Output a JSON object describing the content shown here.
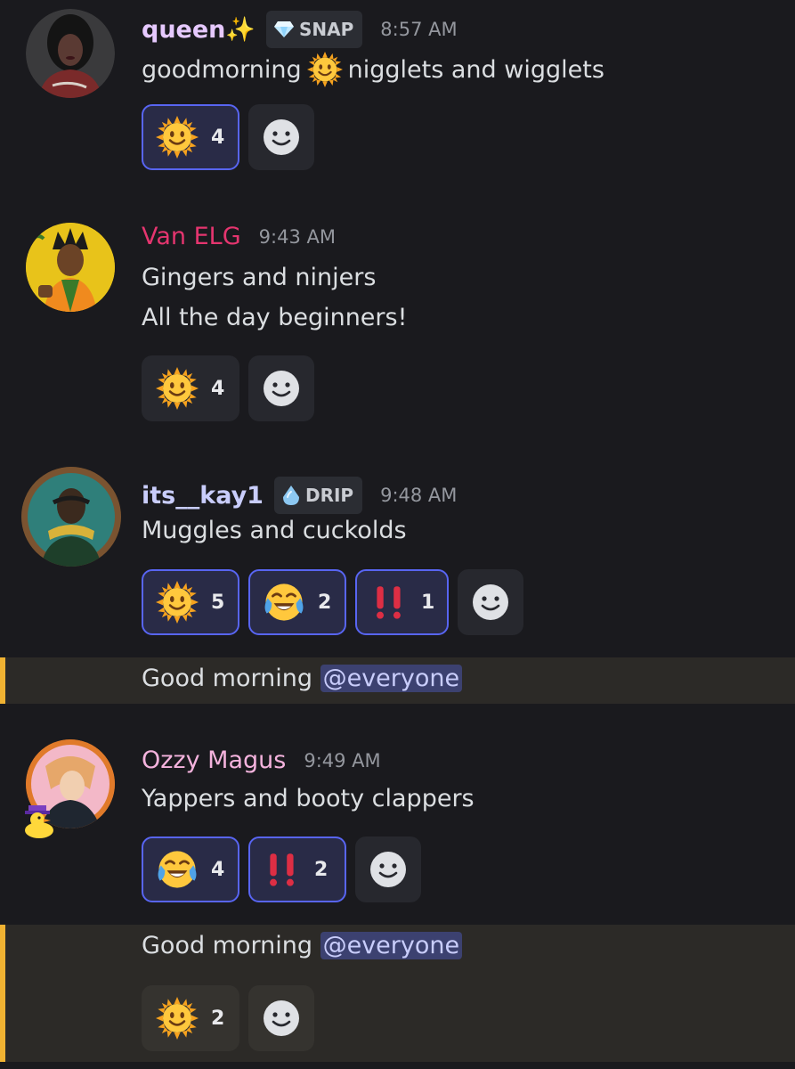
{
  "messages": [
    {
      "username": "queen✨",
      "tag": "SNAP",
      "tag_icon": "gem-icon",
      "time": "8:57 AM",
      "lines": [
        "goodmorning",
        "nigglets and wigglets"
      ],
      "reactions": [
        {
          "emoji": "sun-icon",
          "count": "4",
          "selected": true
        }
      ]
    },
    {
      "username": "Van ELG",
      "time": "9:43 AM",
      "lines": [
        "Gingers and ninjers",
        "All the day beginners!"
      ],
      "reactions": [
        {
          "emoji": "sun-icon",
          "count": "4",
          "selected": false
        }
      ]
    },
    {
      "username": "its__kay1",
      "tag": "DRIP",
      "tag_icon": "droplet-icon",
      "time": "9:48 AM",
      "lines": [
        "Muggles and cuckolds"
      ],
      "reactions": [
        {
          "emoji": "sun-icon",
          "count": "5",
          "selected": true
        },
        {
          "emoji": "tears-of-joy-icon",
          "count": "2",
          "selected": true
        },
        {
          "emoji": "double-exclamation-icon",
          "count": "1",
          "selected": true
        }
      ]
    },
    {
      "system_text": "Good morning",
      "mention": "@everyone"
    },
    {
      "username": "Ozzy Magus",
      "time": "9:49 AM",
      "lines": [
        "Yappers and booty clappers"
      ],
      "reactions": [
        {
          "emoji": "tears-of-joy-icon",
          "count": "4",
          "selected": true
        },
        {
          "emoji": "double-exclamation-icon",
          "count": "2",
          "selected": true
        }
      ]
    },
    {
      "system_text": "Good morning",
      "mention": "@everyone",
      "reactions": [
        {
          "emoji": "sun-icon",
          "count": "2",
          "selected": false
        }
      ]
    }
  ],
  "colors": {
    "background": "#1a1a1e",
    "username_queen": "#e6c9ff",
    "username_van": "#e5356f",
    "username_kay": "#c9cdfb",
    "username_ozzy": "#f4b3dd",
    "mention_bg": "#3c4170",
    "system_border": "#f0b232",
    "reaction_selected_border": "#5865f2"
  }
}
